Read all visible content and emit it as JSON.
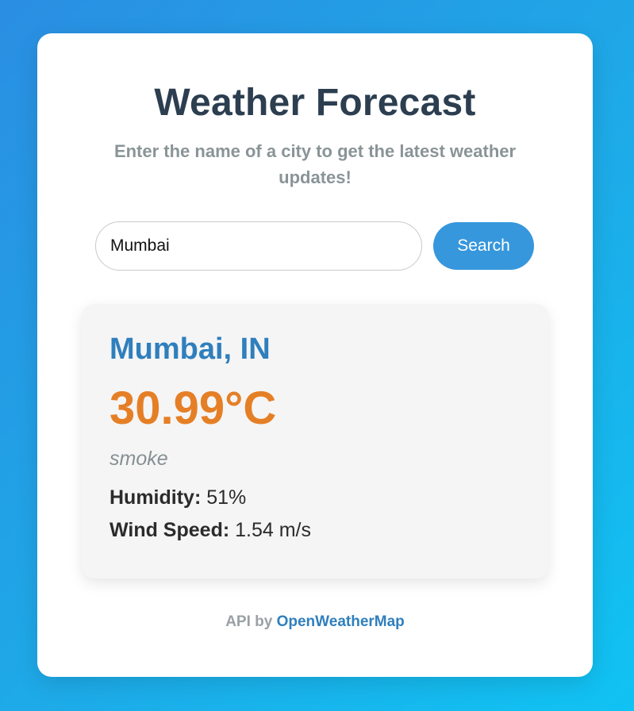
{
  "header": {
    "title": "Weather Forecast",
    "subtitle": "Enter the name of a city to get the latest weather updates!"
  },
  "search": {
    "value": "Mumbai",
    "placeholder": "",
    "button_label": "Search"
  },
  "weather": {
    "location": "Mumbai, IN",
    "temperature": "30.99°C",
    "description": "smoke",
    "humidity_label": "Humidity:",
    "humidity_value": "51%",
    "wind_label": "Wind Speed:",
    "wind_value": "1.54 m/s"
  },
  "footer": {
    "prefix": "API by",
    "link_text": "OpenWeatherMap"
  },
  "colors": {
    "title": "#2c3e50",
    "accent_blue": "#3797dc",
    "city_blue": "#2f7fbd",
    "temp_orange": "#e57f26",
    "gradient_start": "#2a8ee2",
    "gradient_end": "#10c3f3"
  }
}
